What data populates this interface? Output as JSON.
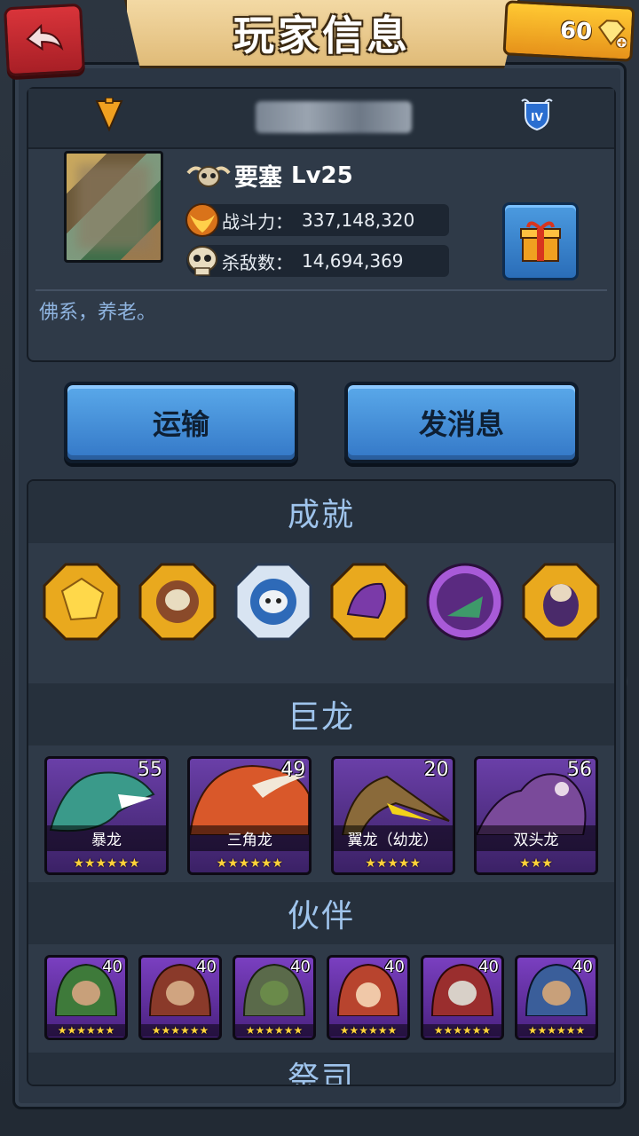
{
  "header": {
    "title": "玩家信息",
    "gems": "60"
  },
  "profile": {
    "title": "要塞",
    "level": "Lv25",
    "power_label": "战斗力：",
    "power_value": "337,148,320",
    "kills_label": "杀敌数：",
    "kills_value": "14,694,369",
    "motto": "佛系，养老。"
  },
  "actions": {
    "transport": "运输",
    "message": "发消息"
  },
  "sections": {
    "achievements": "成就",
    "dragons": "巨龙",
    "partners": "伙伴",
    "priest": "祭司"
  },
  "dragons": [
    {
      "name": "暴龙",
      "level": "55",
      "stars": "★★★★★★",
      "color": "#3a9a8a"
    },
    {
      "name": "三角龙",
      "level": "49",
      "stars": "★★★★★★",
      "color": "#d9582a"
    },
    {
      "name": "翼龙（幼龙）",
      "level": "20",
      "stars": "★★★★★",
      "color": "#8a6a3a"
    },
    {
      "name": "双头龙",
      "level": "56",
      "stars": "★★★",
      "color": "#7a4a9a"
    }
  ],
  "partners": [
    {
      "level": "40",
      "stars": "★★★★★★",
      "color": "#3e7a3a"
    },
    {
      "level": "40",
      "stars": "★★★★★★",
      "color": "#8a3a2a"
    },
    {
      "level": "40",
      "stars": "★★★★★★",
      "color": "#5a6a4a"
    },
    {
      "level": "40",
      "stars": "★★★★★★",
      "color": "#b8442e"
    },
    {
      "level": "40",
      "stars": "★★★★★★",
      "color": "#9a2e2e"
    },
    {
      "level": "40",
      "stars": "★★★★★★",
      "color": "#3a5e9a"
    }
  ]
}
